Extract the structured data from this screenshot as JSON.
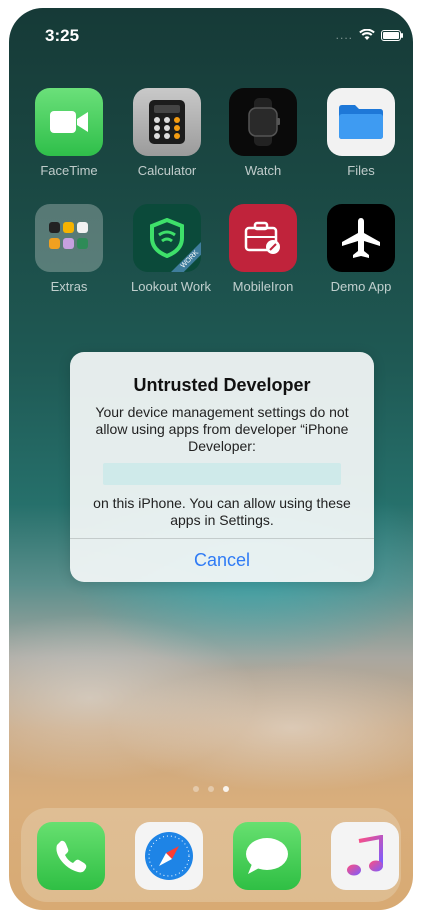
{
  "status_bar": {
    "time": "3:25",
    "signal": "....",
    "wifi": "wifi-icon",
    "battery": "battery-icon"
  },
  "home_apps": [
    {
      "label": "FaceTime",
      "icon": "facetime-icon"
    },
    {
      "label": "Calculator",
      "icon": "calculator-icon"
    },
    {
      "label": "Watch",
      "icon": "watch-icon"
    },
    {
      "label": "Files",
      "icon": "files-icon"
    },
    {
      "label": "Extras",
      "icon": "folder-icon"
    },
    {
      "label": "Lookout Work",
      "icon": "lookout-icon",
      "badge": "WORK"
    },
    {
      "label": "MobileIron",
      "icon": "mobileiron-icon"
    },
    {
      "label": "Demo App",
      "icon": "airplane-icon"
    }
  ],
  "alert": {
    "title": "Untrusted Developer",
    "message": "Your device management settings do not allow using apps from developer “iPhone Developer:",
    "message_after": "on this iPhone. You can allow using these apps in Settings.",
    "cancel_label": "Cancel"
  },
  "page_indicator": {
    "pages": 3,
    "current": 3
  },
  "dock": [
    {
      "icon": "phone-icon"
    },
    {
      "icon": "safari-icon"
    },
    {
      "icon": "messages-icon"
    },
    {
      "icon": "music-icon"
    }
  ],
  "colors": {
    "alert_button": "#2f7bf5",
    "facetime": "#4cd964",
    "lookout": "#0c5c47",
    "mobileiron": "#c0233b"
  }
}
